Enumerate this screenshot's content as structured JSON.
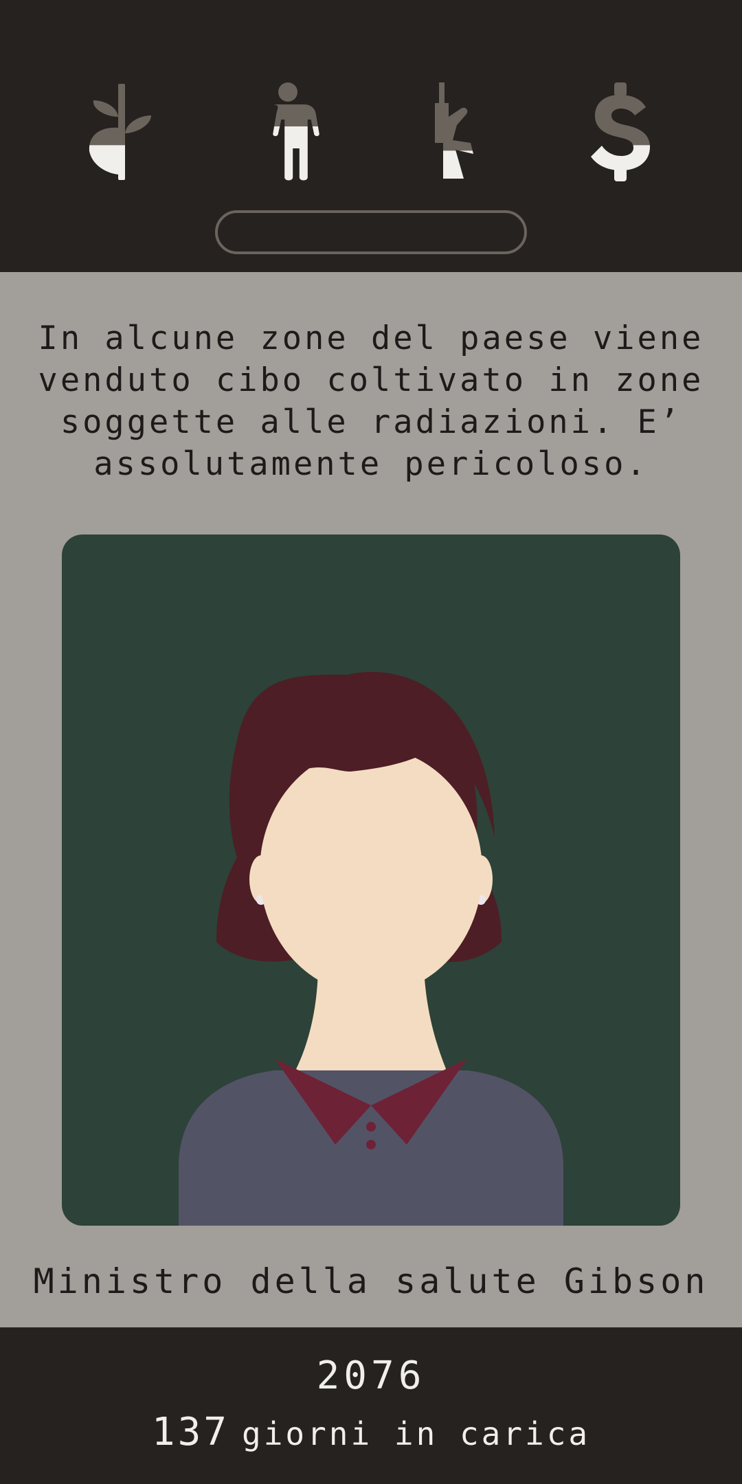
{
  "stats": [
    {
      "icon": "plant-icon",
      "name": "environment",
      "level": 0.38
    },
    {
      "icon": "person-icon",
      "name": "people",
      "level": 0.55
    },
    {
      "icon": "rifle-icon",
      "name": "military",
      "level": 0.33
    },
    {
      "icon": "dollar-icon",
      "name": "money",
      "level": 0.38
    }
  ],
  "colors": {
    "bar_background": "#252220",
    "stat_empty": "#6b645c",
    "stat_filled": "#f1efec",
    "page_background": "#a29e9a",
    "card_background": "#2d4239",
    "hair": "#4d1e25",
    "skin": "#f4dcc2",
    "collar": "#6e2236",
    "shirt": "#535366"
  },
  "card": {
    "question": "In alcune zone del paese viene venduto cibo coltivato in zone soggette alle radiazioni. E’ assolutamente pericoloso.",
    "character_name": "Ministro della salute Gibson"
  },
  "footer": {
    "year": "2076",
    "days_in_office": "137",
    "days_label": "giorni in carica"
  }
}
